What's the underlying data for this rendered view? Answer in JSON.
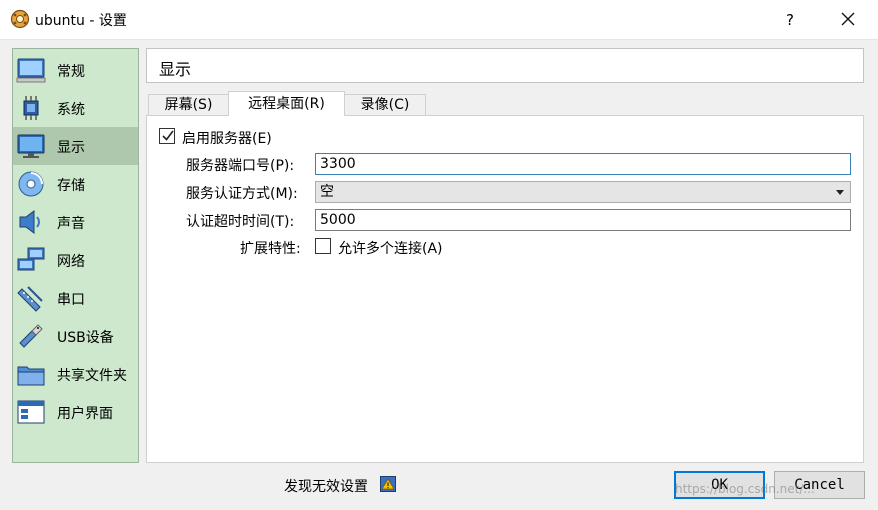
{
  "window": {
    "title": "ubuntu - 设置",
    "help_label": "?"
  },
  "sidebar": {
    "items": [
      {
        "label": "常规",
        "icon": "general-icon"
      },
      {
        "label": "系统",
        "icon": "system-icon"
      },
      {
        "label": "显示",
        "icon": "display-icon",
        "selected": true
      },
      {
        "label": "存储",
        "icon": "storage-icon"
      },
      {
        "label": "声音",
        "icon": "audio-icon"
      },
      {
        "label": "网络",
        "icon": "network-icon"
      },
      {
        "label": "串口",
        "icon": "serial-port-icon"
      },
      {
        "label": "USB设备",
        "icon": "usb-icon"
      },
      {
        "label": "共享文件夹",
        "icon": "shared-folder-icon"
      },
      {
        "label": "用户界面",
        "icon": "user-interface-icon"
      }
    ]
  },
  "header": {
    "title": "显示"
  },
  "tabs": [
    {
      "label": "屏幕(S)"
    },
    {
      "label": "远程桌面(R)",
      "active": true
    },
    {
      "label": "录像(C)"
    }
  ],
  "form": {
    "enable_server": {
      "label": "启用服务器(E)",
      "checked": true
    },
    "port": {
      "label": "服务器端口号(P):",
      "value": "3300"
    },
    "auth_method": {
      "label": "服务认证方式(M):",
      "value": "空"
    },
    "auth_timeout": {
      "label": "认证超时时间(T):",
      "value": "5000"
    },
    "extended": {
      "label": "扩展特性:",
      "checkbox_label": "允许多个连接(A)",
      "checked": false
    }
  },
  "footer": {
    "warning_text": "发现无效设置",
    "ok_label": "OK",
    "cancel_label": "Cancel",
    "watermark": "https://blog.csdn.net/..."
  },
  "colors": {
    "sidebar_bg": "#cde8cd",
    "selected_bg": "#aec8ae",
    "accent": "#0078d7"
  }
}
